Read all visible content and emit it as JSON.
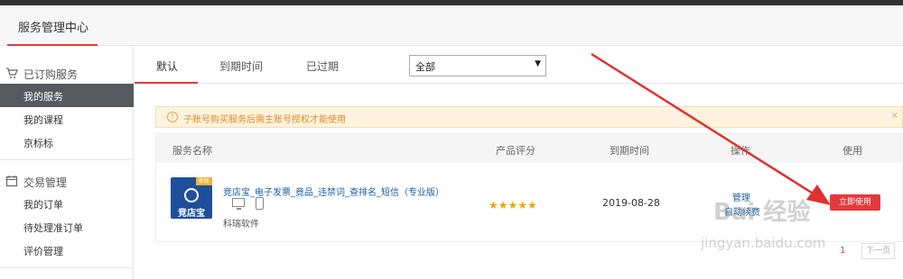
{
  "header": {
    "title": "服务管理中心"
  },
  "sidebar": {
    "groups": [
      {
        "title": "已订购服务",
        "icon": "cart-icon",
        "items": [
          {
            "label": "我的服务",
            "active": true
          },
          {
            "label": "我的课程"
          },
          {
            "label": "京标标"
          }
        ]
      },
      {
        "title": "交易管理",
        "icon": "calendar-icon",
        "items": [
          {
            "label": "我的订单"
          },
          {
            "label": "待处理准订单"
          },
          {
            "label": "评价管理"
          }
        ]
      }
    ]
  },
  "tabs": [
    {
      "label": "默认",
      "active": true
    },
    {
      "label": "到期时间"
    },
    {
      "label": "已过期"
    }
  ],
  "filter": {
    "selected": "全部"
  },
  "notice": {
    "text": "子账号购买服务后需主账号授权才能使用",
    "icon": "warning-icon",
    "close": "×"
  },
  "table": {
    "headers": [
      "服务名称",
      "产品评分",
      "到期时间",
      "操作",
      "使用"
    ],
    "rows": [
      {
        "logo_text": "竞店宝",
        "logo_badge": "新版",
        "name": "竞店宝_电子发票_竟品_违禁词_查排名_短信（专业版）",
        "vendor": "科瑞软件",
        "rating": 5,
        "stars": "★★★★★",
        "expire": "2019-08-28",
        "actions": [
          "管理",
          "自动续费"
        ],
        "use_label": "立即使用"
      }
    ]
  },
  "pager": {
    "current": "1",
    "next": "下一页"
  },
  "watermark": {
    "text": "Bai 经验",
    "url": "jingyan.baidu.com"
  },
  "colors": {
    "accent": "#e4393c",
    "link": "#1a5fa3",
    "star": "#f0a500",
    "sidebar_active": "#565a5e"
  }
}
